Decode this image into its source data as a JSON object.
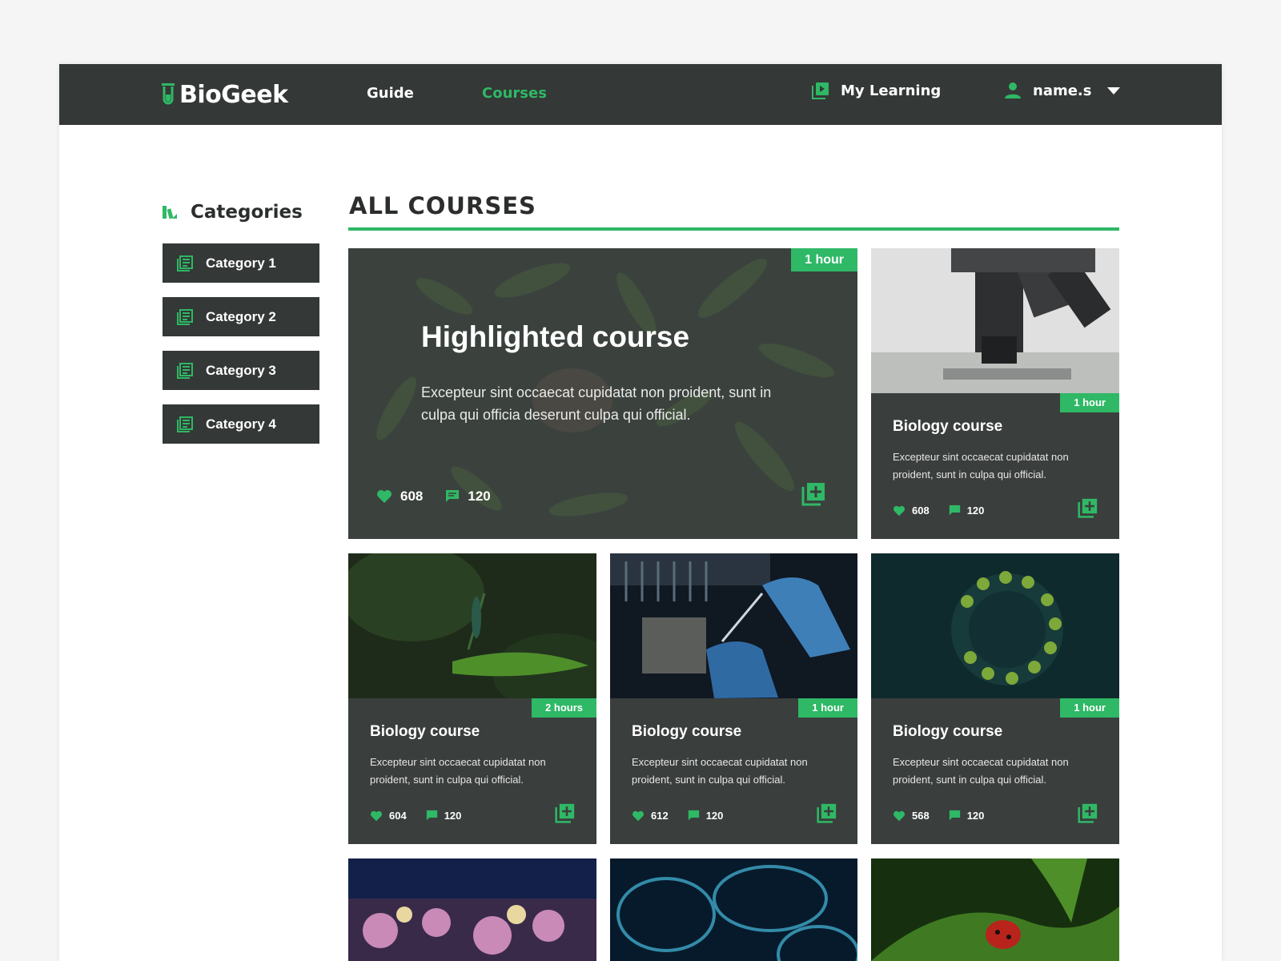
{
  "brand": {
    "name": "BioGeek",
    "accent": "#2fb866",
    "dark": "#343836"
  },
  "nav": {
    "guide": "Guide",
    "courses": "Courses",
    "my_learning": "My Learning",
    "user": "name.s"
  },
  "sidebar": {
    "title": "Categories",
    "items": [
      {
        "label": "Category 1"
      },
      {
        "label": "Category 2"
      },
      {
        "label": "Category 3"
      },
      {
        "label": "Category 4"
      }
    ]
  },
  "main": {
    "title": "ALL COURSES",
    "highlight": {
      "duration": "1 hour",
      "title": "Highlighted course",
      "description": "Excepteur sint occaecat cupidatat non proident, sunt in culpa qui officia deserunt culpa qui official.",
      "likes": "608",
      "comments": "120"
    },
    "courses": [
      {
        "duration": "1 hour",
        "title": "Biology course",
        "description": "Excepteur sint occaecat cupidatat non proident, sunt in culpa qui official.",
        "likes": "608",
        "comments": "120",
        "image": "microscope"
      },
      {
        "duration": "2 hours",
        "title": "Biology course",
        "description": "Excepteur sint occaecat cupidatat non proident, sunt in culpa qui official.",
        "likes": "604",
        "comments": "120",
        "image": "dragonfly"
      },
      {
        "duration": "1 hour",
        "title": "Biology course",
        "description": "Excepteur sint occaecat cupidatat non proident, sunt in culpa qui official.",
        "likes": "612",
        "comments": "120",
        "image": "lab-syringe"
      },
      {
        "duration": "1 hour",
        "title": "Biology course",
        "description": "Excepteur sint occaecat cupidatat non proident, sunt in culpa qui official.",
        "likes": "568",
        "comments": "120",
        "image": "diatom"
      }
    ],
    "bottom_images": [
      "coral-reef",
      "cells",
      "ladybug"
    ]
  }
}
